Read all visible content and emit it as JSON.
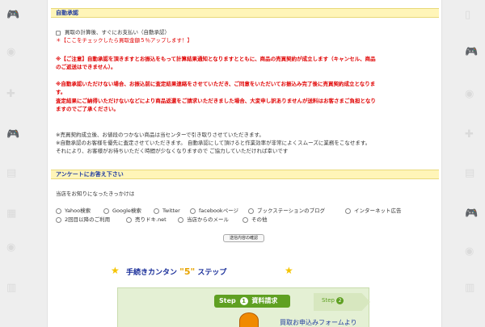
{
  "section_auto": {
    "title": "自動承認",
    "checkbox_label": "買取の計算後、すぐにお支払い（自動承認）",
    "checkbox_bonus": "＊【ここをチェックしたら買取金額５％アップします！】",
    "note1_line1": "※【ご注意】自動承認を頂きますとお振込をもって計算結果通知となりますとともに、商品の売買契約が成立します（キャンセル、商品",
    "note1_line2": "のご返送はできません）。",
    "note2_line1": "※自動承認いただけない場合、お振込前に査定結果連絡をさせていただき、ご同意をいただいてお振込み完了後に売買契約成立となりま",
    "note2_line2": "す。",
    "note2_line3": "査定結果にご納得いただけないなどにより商品返還をご請求いただきました場合、大変申し訳ありませんが送料はお客さまご負担となり",
    "note2_line4": "ますのでご了承ください。",
    "info_line1": "※売買契約成立後、お値段のつかない商品は当センターで引き取りさせていただきます。",
    "info_line2": "※自動承認のお客様を優先に査定させていただきます。 自動承認にして頂けると作業効率が非常によくスムーズに業務をこなせます。",
    "info_line3": "それにより、お客様がお待ちいただく時間が少なくなりますので ご協力していただければ幸いです"
  },
  "section_survey": {
    "title": "アンケートにお答え下さい",
    "question": "当店をお知りになったきっかけは",
    "options_row1": [
      "Yahoo検索",
      "Google検索",
      "Twitter",
      "facebookページ",
      "ブックステーションのブログ",
      "インターネット広告"
    ],
    "options_row2": [
      "2回目以降のご利用",
      "売りドキ.net",
      "当店からのメール",
      "その他"
    ],
    "submit_label": "送信内容の確認"
  },
  "banner": {
    "title_pre": "手続きカンタン",
    "title_num": "\"5\"",
    "title_post": "ステップ",
    "step1_label": "Step",
    "step1_num": "1",
    "step1_text": "資料請求",
    "step2_label": "Step",
    "step2_num": "2",
    "form_text": "買取お申込みフォームより"
  },
  "colors": {
    "accent_red": "#e00000",
    "heading_blue": "#1e3aa0",
    "band_yellow": "#fff5b8",
    "step_green": "#5fa022"
  }
}
